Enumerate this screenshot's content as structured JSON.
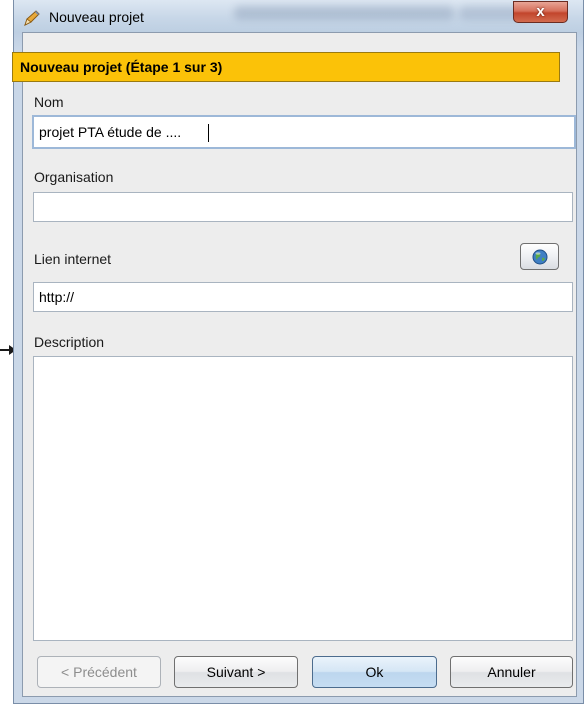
{
  "window": {
    "title": "Nouveau projet",
    "close_glyph": "x",
    "icon": "pencil-icon"
  },
  "step_header": "Nouveau projet (Étape 1 sur 3)",
  "fields": {
    "nom": {
      "label": "Nom",
      "value": "projet PTA étude de ...."
    },
    "organisation": {
      "label": "Organisation",
      "value": ""
    },
    "lien_internet": {
      "label": "Lien internet",
      "value": "http://",
      "button_icon": "globe-icon"
    },
    "description": {
      "label": "Description",
      "value": ""
    }
  },
  "buttons": {
    "precedent": "< Précédent",
    "suivant": "Suivant >",
    "ok": "Ok",
    "annuler": "Annuler"
  },
  "colors": {
    "header_bg": "#FBC208",
    "dialog_frame": "#C4D3E4",
    "panel_bg": "#EDEDED",
    "close_red": "#C2452C"
  }
}
